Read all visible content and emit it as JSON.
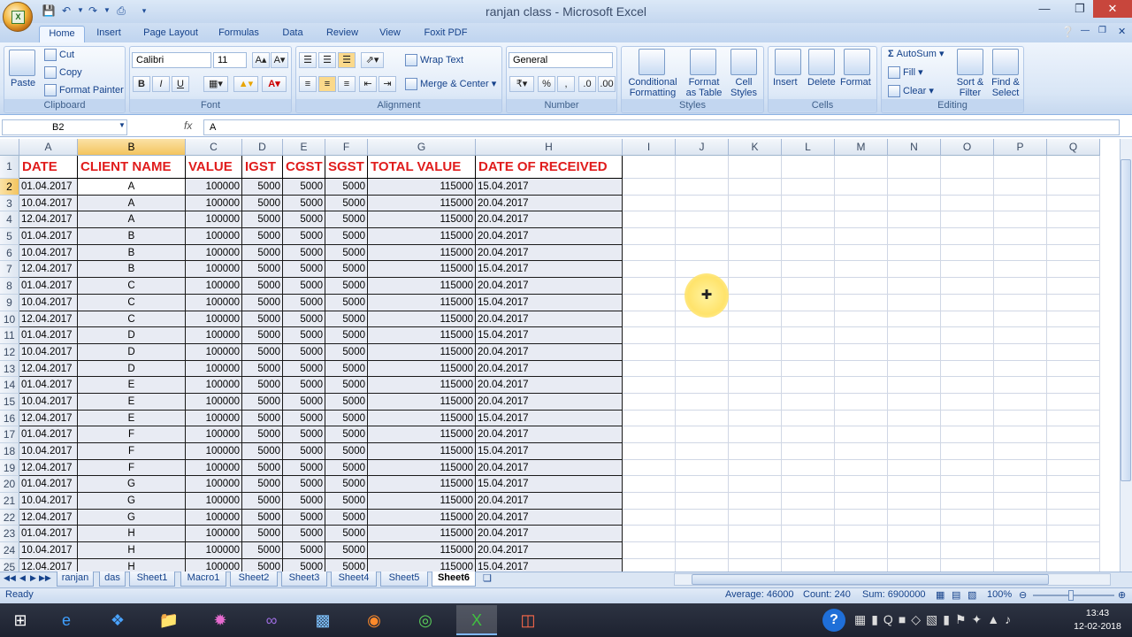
{
  "window": {
    "title": "ranjan class - Microsoft Excel"
  },
  "ribbon_tabs": [
    "Home",
    "Insert",
    "Page Layout",
    "Formulas",
    "Data",
    "Review",
    "View",
    "Foxit PDF"
  ],
  "clipboard": {
    "paste": "Paste",
    "cut": "Cut",
    "copy": "Copy",
    "format_painter": "Format Painter",
    "title": "Clipboard"
  },
  "font": {
    "name": "Calibri",
    "size": "11",
    "bold": "B",
    "italic": "I",
    "underline": "U",
    "title": "Font"
  },
  "alignment": {
    "wrap_text": "Wrap Text",
    "merge_center": "Merge & Center",
    "title": "Alignment"
  },
  "number": {
    "format": "General",
    "percent": "%",
    "comma": ",",
    "title": "Number"
  },
  "styles": {
    "conditional": "Conditional",
    "formatting": "Formatting",
    "format": "Format",
    "as_table": "as Table",
    "cell": "Cell",
    "cell_styles": "Styles",
    "title": "Styles"
  },
  "cells": {
    "insert": "Insert",
    "delete": "Delete",
    "format": "Format",
    "title": "Cells"
  },
  "editing": {
    "autosum": "AutoSum",
    "fill": "Fill",
    "clear": "Clear",
    "sort": "Sort &",
    "filter": "Filter",
    "find": "Find &",
    "select": "Select",
    "title": "Editing"
  },
  "formula_bar": {
    "name_box": "B2",
    "fx": "fx",
    "content": "A"
  },
  "columns": [
    "A",
    "B",
    "C",
    "D",
    "E",
    "F",
    "G",
    "H",
    "I",
    "J",
    "K",
    "L",
    "M",
    "N",
    "O",
    "P",
    "Q"
  ],
  "headers": [
    "DATE",
    "CLIENT NAME",
    "VALUE",
    "IGST",
    "CGST",
    "SGST",
    "TOTAL VALUE",
    "DATE OF RECEIVED"
  ],
  "rows": [
    [
      "2",
      "01.04.2017",
      "A",
      "100000",
      "5000",
      "5000",
      "5000",
      "115000",
      "15.04.2017"
    ],
    [
      "3",
      "10.04.2017",
      "A",
      "100000",
      "5000",
      "5000",
      "5000",
      "115000",
      "20.04.2017"
    ],
    [
      "4",
      "12.04.2017",
      "A",
      "100000",
      "5000",
      "5000",
      "5000",
      "115000",
      "20.04.2017"
    ],
    [
      "5",
      "01.04.2017",
      "B",
      "100000",
      "5000",
      "5000",
      "5000",
      "115000",
      "20.04.2017"
    ],
    [
      "6",
      "10.04.2017",
      "B",
      "100000",
      "5000",
      "5000",
      "5000",
      "115000",
      "20.04.2017"
    ],
    [
      "7",
      "12.04.2017",
      "B",
      "100000",
      "5000",
      "5000",
      "5000",
      "115000",
      "15.04.2017"
    ],
    [
      "8",
      "01.04.2017",
      "C",
      "100000",
      "5000",
      "5000",
      "5000",
      "115000",
      "20.04.2017"
    ],
    [
      "9",
      "10.04.2017",
      "C",
      "100000",
      "5000",
      "5000",
      "5000",
      "115000",
      "15.04.2017"
    ],
    [
      "10",
      "12.04.2017",
      "C",
      "100000",
      "5000",
      "5000",
      "5000",
      "115000",
      "20.04.2017"
    ],
    [
      "11",
      "01.04.2017",
      "D",
      "100000",
      "5000",
      "5000",
      "5000",
      "115000",
      "15.04.2017"
    ],
    [
      "12",
      "10.04.2017",
      "D",
      "100000",
      "5000",
      "5000",
      "5000",
      "115000",
      "20.04.2017"
    ],
    [
      "13",
      "12.04.2017",
      "D",
      "100000",
      "5000",
      "5000",
      "5000",
      "115000",
      "20.04.2017"
    ],
    [
      "14",
      "01.04.2017",
      "E",
      "100000",
      "5000",
      "5000",
      "5000",
      "115000",
      "20.04.2017"
    ],
    [
      "15",
      "10.04.2017",
      "E",
      "100000",
      "5000",
      "5000",
      "5000",
      "115000",
      "20.04.2017"
    ],
    [
      "16",
      "12.04.2017",
      "E",
      "100000",
      "5000",
      "5000",
      "5000",
      "115000",
      "15.04.2017"
    ],
    [
      "17",
      "01.04.2017",
      "F",
      "100000",
      "5000",
      "5000",
      "5000",
      "115000",
      "20.04.2017"
    ],
    [
      "18",
      "10.04.2017",
      "F",
      "100000",
      "5000",
      "5000",
      "5000",
      "115000",
      "15.04.2017"
    ],
    [
      "19",
      "12.04.2017",
      "F",
      "100000",
      "5000",
      "5000",
      "5000",
      "115000",
      "20.04.2017"
    ],
    [
      "20",
      "01.04.2017",
      "G",
      "100000",
      "5000",
      "5000",
      "5000",
      "115000",
      "15.04.2017"
    ],
    [
      "21",
      "10.04.2017",
      "G",
      "100000",
      "5000",
      "5000",
      "5000",
      "115000",
      "20.04.2017"
    ],
    [
      "22",
      "12.04.2017",
      "G",
      "100000",
      "5000",
      "5000",
      "5000",
      "115000",
      "20.04.2017"
    ],
    [
      "23",
      "01.04.2017",
      "H",
      "100000",
      "5000",
      "5000",
      "5000",
      "115000",
      "20.04.2017"
    ],
    [
      "24",
      "10.04.2017",
      "H",
      "100000",
      "5000",
      "5000",
      "5000",
      "115000",
      "20.04.2017"
    ],
    [
      "25",
      "12.04.2017",
      "H",
      "100000",
      "5000",
      "5000",
      "5000",
      "115000",
      "15.04.2017"
    ]
  ],
  "sheet_tabs": [
    "ranjan",
    "das",
    "Sheet1",
    "Macro1",
    "Sheet2",
    "Sheet3",
    "Sheet4",
    "Sheet5",
    "Sheet6"
  ],
  "status": {
    "mode": "Ready",
    "average": "Average: 46000",
    "count": "Count: 240",
    "sum": "Sum: 6900000",
    "zoom": "100%"
  },
  "clock": {
    "time": "13:43",
    "date": "12-02-2018"
  },
  "colors": {
    "header_text": "#e01c1c",
    "data_fill": "#e8ebf3",
    "selected_header": "#f3c45e"
  }
}
